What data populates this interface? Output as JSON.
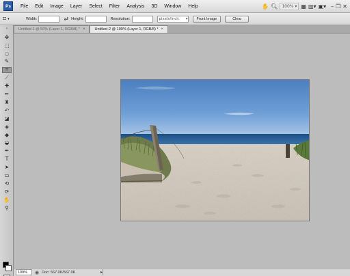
{
  "app": {
    "logo": "Ps"
  },
  "menu": [
    "File",
    "Edit",
    "Image",
    "Layer",
    "Select",
    "Filter",
    "Analysis",
    "3D",
    "Window",
    "Help"
  ],
  "menubar_right": {
    "zoom": "100%"
  },
  "options": {
    "width_label": "Width:",
    "width_value": "",
    "height_label": "Height:",
    "height_value": "",
    "resolution_label": "Resolution:",
    "resolution_value": "",
    "unit": "pixels/inch",
    "front_image": "Front Image",
    "clear": "Clear"
  },
  "tabs": [
    {
      "label": "Untitled-1 @ 50% (Layer 1, RGB/8) *",
      "active": false
    },
    {
      "label": "Untitled-2 @ 100% (Layer 1, RGB/8) *",
      "active": true
    }
  ],
  "tools": [
    {
      "name": "move-tool-icon",
      "glyph": "✥"
    },
    {
      "name": "marquee-tool-icon",
      "glyph": "⬚"
    },
    {
      "name": "lasso-tool-icon",
      "glyph": "◌"
    },
    {
      "name": "quick-selection-tool-icon",
      "glyph": "✎"
    },
    {
      "name": "crop-tool-icon",
      "glyph": "⌗"
    },
    {
      "name": "eyedropper-tool-icon",
      "glyph": "⟋"
    },
    {
      "name": "spot-healing-tool-icon",
      "glyph": "✚"
    },
    {
      "name": "brush-tool-icon",
      "glyph": "✏"
    },
    {
      "name": "clone-stamp-tool-icon",
      "glyph": "♜"
    },
    {
      "name": "history-brush-tool-icon",
      "glyph": "↶"
    },
    {
      "name": "eraser-tool-icon",
      "glyph": "◪"
    },
    {
      "name": "paint-bucket-tool-icon",
      "glyph": "◈"
    },
    {
      "name": "blur-tool-icon",
      "glyph": "◆"
    },
    {
      "name": "dodge-tool-icon",
      "glyph": "◒"
    },
    {
      "name": "pen-tool-icon",
      "glyph": "✒"
    },
    {
      "name": "type-tool-icon",
      "glyph": "T"
    },
    {
      "name": "path-selection-tool-icon",
      "glyph": "➤"
    },
    {
      "name": "shape-tool-icon",
      "glyph": "▭"
    },
    {
      "name": "3d-rotate-tool-icon",
      "glyph": "⟲"
    },
    {
      "name": "3d-orbit-tool-icon",
      "glyph": "⟳"
    },
    {
      "name": "hand-tool-icon",
      "glyph": "✋"
    },
    {
      "name": "zoom-tool-icon",
      "glyph": "⚲"
    }
  ],
  "status": {
    "zoom": "100%",
    "doc": "Doc: 567.0K/567.0K"
  },
  "colors": {
    "foreground": "#000000",
    "background": "#ffffff"
  }
}
